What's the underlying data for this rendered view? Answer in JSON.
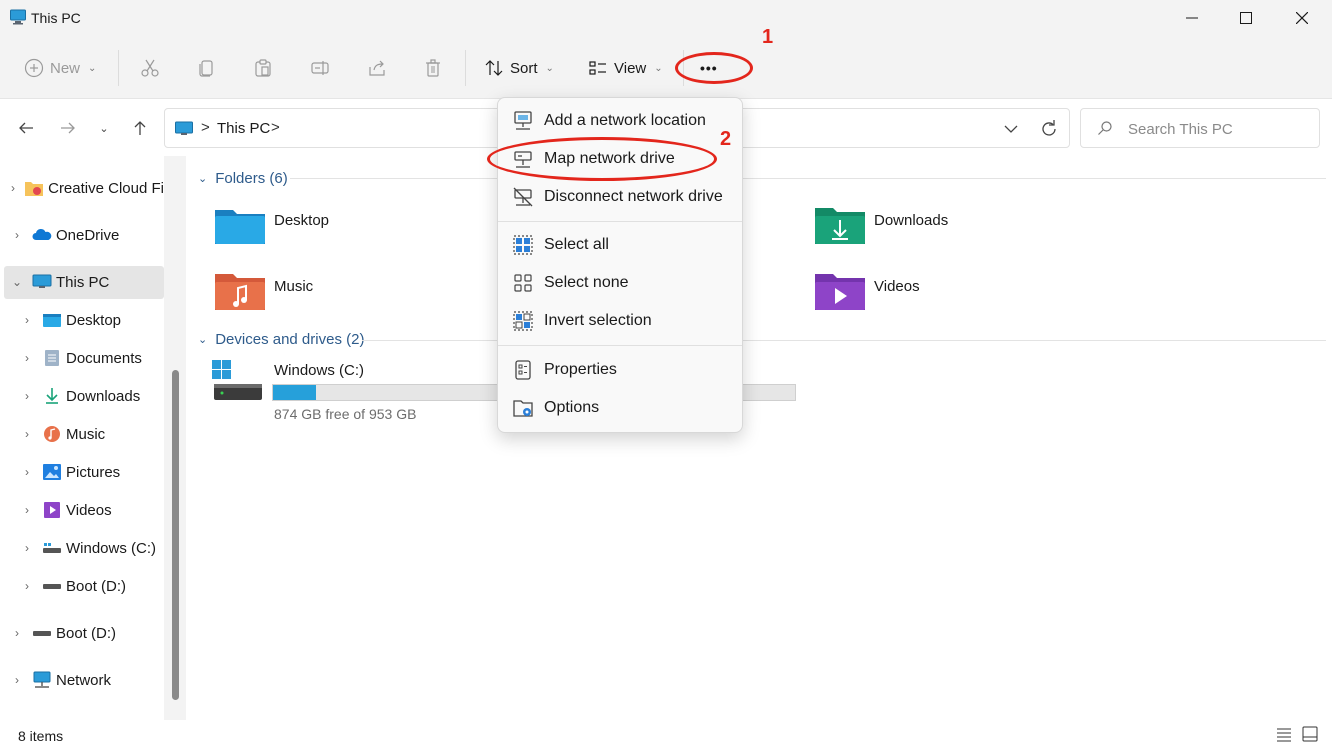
{
  "window": {
    "title": "This PC"
  },
  "toolbar": {
    "new_label": "New",
    "sort_label": "Sort",
    "view_label": "View",
    "more_label": "•••"
  },
  "address": {
    "segment": "This PC",
    "sep": ">"
  },
  "search": {
    "placeholder": "Search This PC"
  },
  "sidebar": {
    "items": [
      {
        "label": "Creative Cloud Fi",
        "icon": "creative-cloud-folder-icon"
      },
      {
        "label": "OneDrive",
        "icon": "onedrive-cloud-icon"
      },
      {
        "label": "This PC",
        "icon": "monitor-icon"
      },
      {
        "label": "Desktop",
        "icon": "desktop-folder-icon"
      },
      {
        "label": "Documents",
        "icon": "documents-icon"
      },
      {
        "label": "Downloads",
        "icon": "download-arrow-icon"
      },
      {
        "label": "Music",
        "icon": "music-icon"
      },
      {
        "label": "Pictures",
        "icon": "pictures-icon"
      },
      {
        "label": "Videos",
        "icon": "videos-icon"
      },
      {
        "label": "Windows (C:)",
        "icon": "drive-c-icon"
      },
      {
        "label": "Boot (D:)",
        "icon": "drive-icon"
      },
      {
        "label": "Boot (D:)",
        "icon": "drive-icon"
      },
      {
        "label": "Network",
        "icon": "network-icon"
      }
    ]
  },
  "content": {
    "folders_header": "Folders (6)",
    "folders": [
      {
        "name": "Desktop",
        "color": "#1e88e5"
      },
      {
        "name": "Downloads",
        "color": "#1aa37a"
      },
      {
        "name": "Music",
        "color": "#e8714a"
      },
      {
        "name": "Videos",
        "color": "#8e44c8"
      }
    ],
    "devices_header": "Devices and drives (2)",
    "drive": {
      "name": "Windows (C:)",
      "free": "874 GB free of 953 GB",
      "used_fraction": 0.083
    }
  },
  "menu": {
    "items": [
      {
        "label": "Add a network location",
        "icon": "network-location-icon"
      },
      {
        "label": "Map network drive",
        "icon": "map-drive-icon"
      },
      {
        "label": "Disconnect network drive",
        "icon": "disconnect-drive-icon"
      },
      {
        "label": "Select all",
        "icon": "select-all-icon"
      },
      {
        "label": "Select none",
        "icon": "select-none-icon"
      },
      {
        "label": "Invert selection",
        "icon": "invert-selection-icon"
      },
      {
        "label": "Properties",
        "icon": "properties-icon"
      },
      {
        "label": "Options",
        "icon": "options-icon"
      }
    ]
  },
  "annotations": {
    "one": "1",
    "two": "2",
    "color": "#e3261c"
  },
  "status": {
    "items_count": "8 items"
  }
}
